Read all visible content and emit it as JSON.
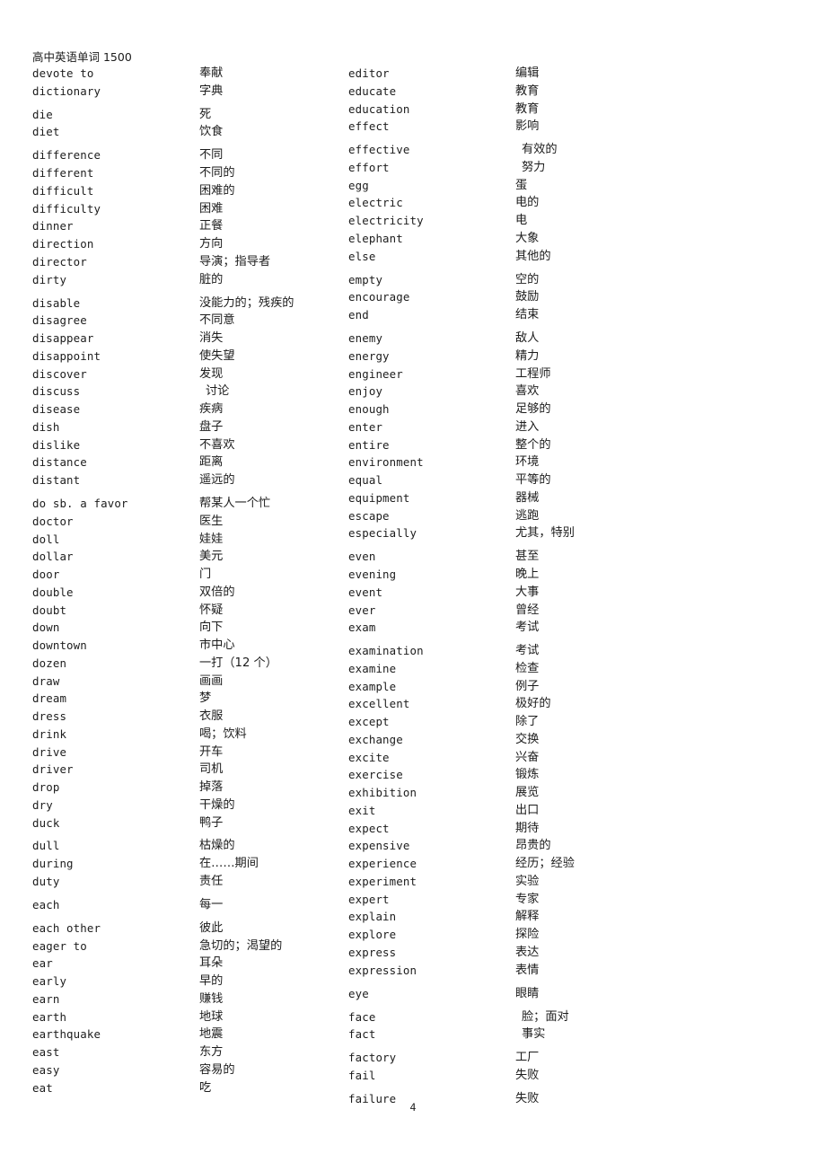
{
  "document": {
    "title": "高中英语单词 1500",
    "page_number": "4",
    "columns": [
      {
        "name": "left-column",
        "groups": [
          {
            "entries": [
              {
                "term": "devote to",
                "gloss": "奉献"
              },
              {
                "term": "dictionary",
                "gloss": "字典"
              }
            ]
          },
          {
            "entries": [
              {
                "term": "die",
                "gloss": "死"
              },
              {
                "term": "diet",
                "gloss": "饮食"
              }
            ]
          },
          {
            "entries": [
              {
                "term": "difference",
                "gloss": "不同"
              },
              {
                "term": "different",
                "gloss": "不同的"
              },
              {
                "term": "difficult",
                "gloss": "困难的"
              },
              {
                "term": "difficulty",
                "gloss": "困难"
              },
              {
                "term": "dinner",
                "gloss": "正餐"
              },
              {
                "term": "direction",
                "gloss": "方向"
              },
              {
                "term": "director",
                "gloss": "导演；指导者"
              },
              {
                "term": "dirty",
                "gloss": "脏的"
              }
            ]
          },
          {
            "entries": [
              {
                "term": "disable",
                "gloss": "没能力的；残疾的"
              },
              {
                "term": "disagree",
                "gloss": "不同意"
              },
              {
                "term": "disappear",
                "gloss": "消失"
              },
              {
                "term": "disappoint",
                "gloss": "使失望"
              },
              {
                "term": "discover",
                "gloss": "发现"
              },
              {
                "term": "discuss",
                "gloss": "讨论",
                "indent": true
              },
              {
                "term": "disease",
                "gloss": "疾病"
              },
              {
                "term": "dish",
                "gloss": "盘子"
              },
              {
                "term": "dislike",
                "gloss": "不喜欢"
              },
              {
                "term": "distance",
                "gloss": "距离"
              },
              {
                "term": "distant",
                "gloss": "遥远的"
              }
            ]
          },
          {
            "entries": [
              {
                "term": "do sb. a favor",
                "gloss": "帮某人一个忙"
              },
              {
                "term": "doctor",
                "gloss": "医生"
              },
              {
                "term": "doll",
                "gloss": "娃娃"
              },
              {
                "term": "dollar",
                "gloss": "美元"
              },
              {
                "term": "door",
                "gloss": "门"
              },
              {
                "term": "double",
                "gloss": "双倍的"
              },
              {
                "term": "doubt",
                "gloss": "怀疑"
              },
              {
                "term": "down",
                "gloss": "向下"
              },
              {
                "term": "downtown",
                "gloss": "市中心"
              },
              {
                "term": "dozen",
                "gloss": "一打（12 个）"
              },
              {
                "term": "draw",
                "gloss": "画画"
              },
              {
                "term": "dream",
                "gloss": "梦"
              },
              {
                "term": "dress",
                "gloss": "衣服"
              },
              {
                "term": "drink",
                "gloss": "喝；饮料"
              },
              {
                "term": "drive",
                "gloss": "开车"
              },
              {
                "term": "driver",
                "gloss": "司机"
              },
              {
                "term": "drop",
                "gloss": "掉落"
              },
              {
                "term": "dry",
                "gloss": "干燥的"
              },
              {
                "term": "duck",
                "gloss": "鸭子"
              }
            ]
          },
          {
            "entries": [
              {
                "term": "dull",
                "gloss": "枯燥的"
              },
              {
                "term": "during",
                "gloss": "在……期间"
              },
              {
                "term": "duty",
                "gloss": "责任"
              }
            ]
          },
          {
            "entries": [
              {
                "term": "each",
                "gloss": "每一"
              }
            ]
          },
          {
            "entries": [
              {
                "term": "each other",
                "gloss": "彼此"
              },
              {
                "term": "eager to",
                "gloss": "急切的；渴望的"
              },
              {
                "term": "ear",
                "gloss": "耳朵"
              },
              {
                "term": "early",
                "gloss": "早的"
              },
              {
                "term": "earn",
                "gloss": "赚钱"
              },
              {
                "term": "earth",
                "gloss": "地球"
              },
              {
                "term": "earthquake",
                "gloss": "地震"
              },
              {
                "term": "east",
                "gloss": "东方"
              },
              {
                "term": "easy",
                "gloss": "容易的"
              },
              {
                "term": "eat",
                "gloss": "吃"
              }
            ]
          }
        ]
      },
      {
        "name": "right-column",
        "groups": [
          {
            "entries": [
              {
                "term": "editor",
                "gloss": "编辑"
              },
              {
                "term": "educate",
                "gloss": "教育"
              },
              {
                "term": "education",
                "gloss": "教育"
              },
              {
                "term": "effect",
                "gloss": "影响"
              }
            ]
          },
          {
            "entries": [
              {
                "term": "effective",
                "gloss": "有效的",
                "indent": true
              },
              {
                "term": "effort",
                "gloss": "努力",
                "indent": true
              },
              {
                "term": "egg",
                "gloss": "蛋"
              },
              {
                "term": "electric",
                "gloss": "电的"
              },
              {
                "term": "electricity",
                "gloss": "电"
              },
              {
                "term": "elephant",
                "gloss": "大象"
              },
              {
                "term": "else",
                "gloss": "其他的"
              }
            ]
          },
          {
            "entries": [
              {
                "term": "empty",
                "gloss": "空的"
              },
              {
                "term": "encourage",
                "gloss": "鼓励"
              },
              {
                "term": "end",
                "gloss": "结束"
              }
            ]
          },
          {
            "entries": [
              {
                "term": "enemy",
                "gloss": "敌人"
              },
              {
                "term": "energy",
                "gloss": "精力"
              },
              {
                "term": "engineer",
                "gloss": "工程师"
              },
              {
                "term": "enjoy",
                "gloss": "喜欢"
              },
              {
                "term": "enough",
                "gloss": "足够的"
              },
              {
                "term": "enter",
                "gloss": "进入"
              },
              {
                "term": "entire",
                "gloss": "整个的"
              },
              {
                "term": "environment",
                "gloss": "环境"
              },
              {
                "term": "equal",
                "gloss": "平等的"
              },
              {
                "term": "equipment",
                "gloss": "器械"
              },
              {
                "term": "escape",
                "gloss": "逃跑"
              },
              {
                "term": "especially",
                "gloss": "尤其，特别"
              }
            ]
          },
          {
            "entries": [
              {
                "term": "even",
                "gloss": "甚至"
              },
              {
                "term": "evening",
                "gloss": "晚上"
              },
              {
                "term": "event",
                "gloss": "大事"
              },
              {
                "term": "ever",
                "gloss": "曾经"
              },
              {
                "term": "exam",
                "gloss": "考试"
              }
            ]
          },
          {
            "entries": [
              {
                "term": "examination",
                "gloss": "考试"
              },
              {
                "term": "examine",
                "gloss": "检查"
              },
              {
                "term": "example",
                "gloss": "例子"
              },
              {
                "term": "excellent",
                "gloss": "极好的"
              },
              {
                "term": "except",
                "gloss": "除了"
              },
              {
                "term": "exchange",
                "gloss": "交换"
              },
              {
                "term": "excite",
                "gloss": "兴奋"
              },
              {
                "term": "exercise",
                "gloss": "锻炼"
              },
              {
                "term": "exhibition",
                "gloss": "展览"
              },
              {
                "term": "exit",
                "gloss": "出口"
              },
              {
                "term": "expect",
                "gloss": "期待"
              },
              {
                "term": "expensive",
                "gloss": "昂贵的"
              },
              {
                "term": "experience",
                "gloss": "经历；经验"
              },
              {
                "term": "experiment",
                "gloss": "实验"
              },
              {
                "term": "expert",
                "gloss": "专家"
              },
              {
                "term": "explain",
                "gloss": "解释"
              },
              {
                "term": "explore",
                "gloss": "探险"
              },
              {
                "term": "express",
                "gloss": "表达"
              },
              {
                "term": "expression",
                "gloss": "表情"
              }
            ]
          },
          {
            "entries": [
              {
                "term": "eye",
                "gloss": "眼睛"
              }
            ]
          },
          {
            "entries": [
              {
                "term": "face",
                "gloss": "脸；面对",
                "indent": true
              },
              {
                "term": "fact",
                "gloss": "事实",
                "indent": true
              }
            ]
          },
          {
            "entries": [
              {
                "term": "factory",
                "gloss": "工厂"
              },
              {
                "term": "fail",
                "gloss": "失败"
              }
            ]
          },
          {
            "entries": [
              {
                "term": "failure",
                "gloss": "失败"
              }
            ]
          }
        ]
      }
    ]
  }
}
